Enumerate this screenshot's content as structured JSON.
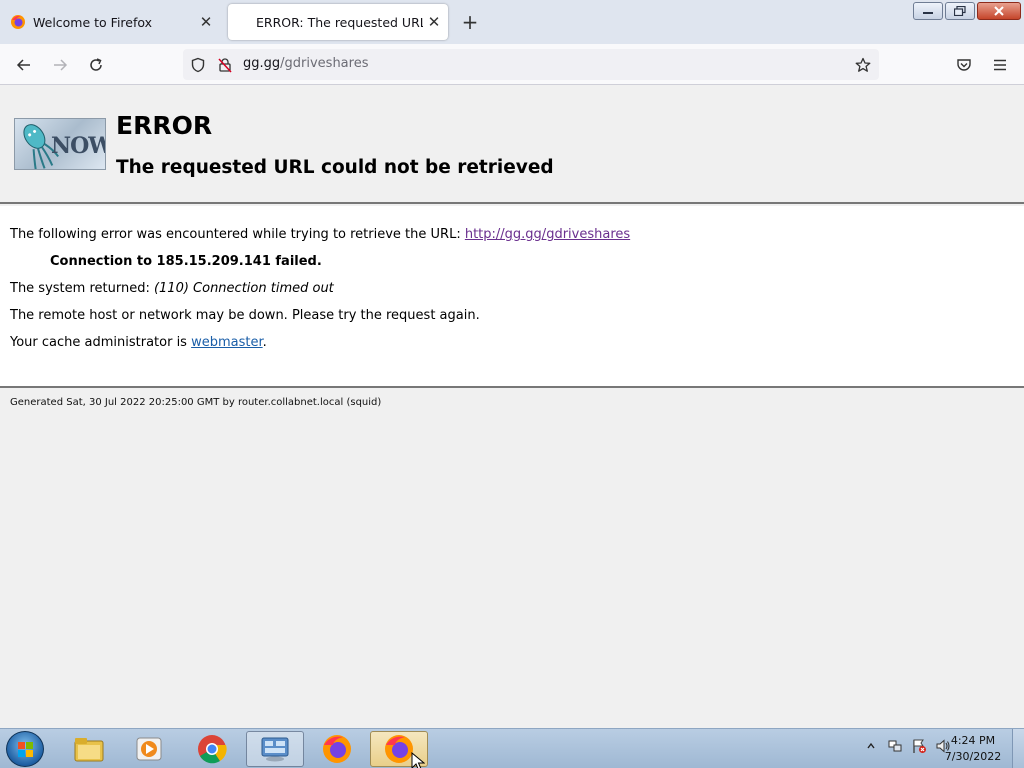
{
  "window": {
    "tabs": [
      {
        "label": "Welcome to Firefox",
        "active": false
      },
      {
        "label": "ERROR: The requested URL could not be retrieved",
        "active": true
      }
    ]
  },
  "navbar": {
    "url_host": "gg.gg",
    "url_path": "/gdriveshares"
  },
  "page": {
    "title": "ERROR",
    "subtitle": "The requested URL could not be retrieved",
    "intro": "The following error was encountered while trying to retrieve the URL: ",
    "url_link": "http://gg.gg/gdriveshares",
    "connection_failed": "Connection to 185.15.209.141 failed.",
    "system_returned_label": "The system returned: ",
    "system_returned_value": "(110) Connection timed out",
    "remote_host_msg": "The remote host or network may be down. Please try the request again.",
    "cache_admin_label": "Your cache administrator is ",
    "cache_admin_link": "webmaster",
    "cache_admin_suffix": ".",
    "generated": "Generated Sat, 30 Jul 2022 20:25:00 GMT by router.collabnet.local (squid)",
    "logo_text": "NOW"
  },
  "taskbar": {
    "time": "4:24 PM",
    "date": "7/30/2022"
  },
  "colors": {
    "link": "#3c3cc8",
    "link_visited": "#6a2f8e",
    "taskbar": "#b9cde3",
    "firefox_orange": "#ff9500",
    "firefox_purple": "#7542e5"
  }
}
